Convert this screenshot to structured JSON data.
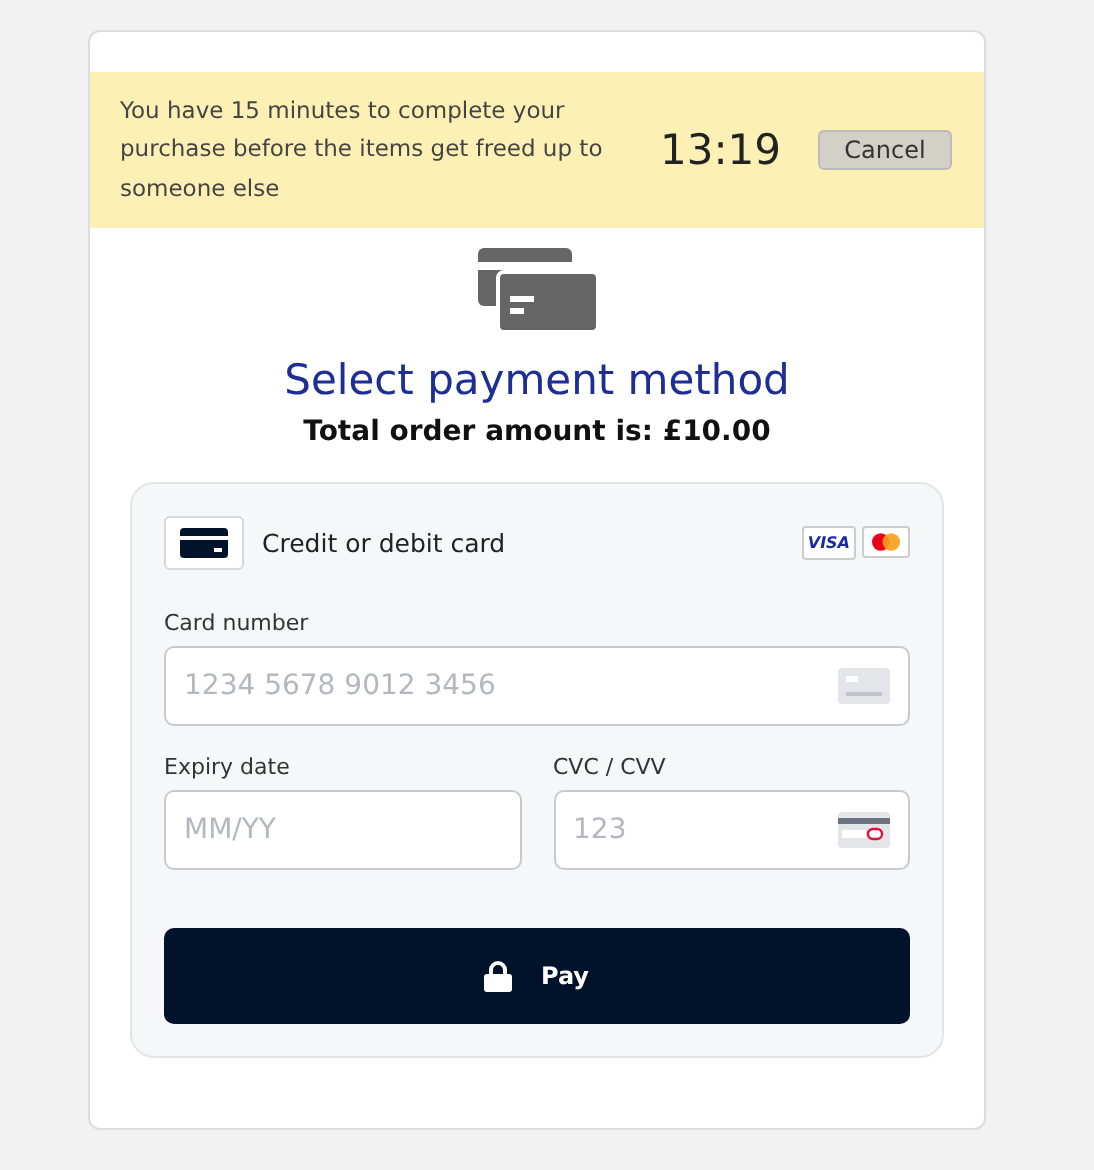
{
  "banner": {
    "message": "You have 15 minutes to complete your purchase before the items get freed up to someone else",
    "timer": "13:19",
    "cancel_label": "Cancel"
  },
  "title": "Select payment method",
  "total": "Total order amount is: £10.00",
  "payment": {
    "method_label": "Credit or debit card",
    "brands": [
      "VISA"
    ],
    "fields": [
      {
        "kind": "card",
        "label": "Card number",
        "placeholder": "1234 5678 9012 3456"
      },
      {
        "kind": "plain",
        "label": "Expiry date",
        "placeholder": "MM/YY"
      },
      {
        "kind": "cvc",
        "label": "CVC / CVV",
        "placeholder": "123"
      }
    ],
    "pay_label": "Pay"
  }
}
